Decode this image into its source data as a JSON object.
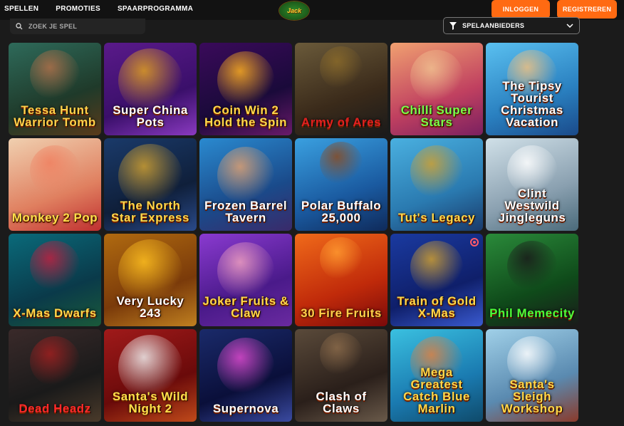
{
  "nav": {
    "games": "SPELLEN",
    "promotions": "PROMOTIES",
    "loyalty": "SPAARPROGRAMMA"
  },
  "logo_text": "Jack",
  "auth": {
    "login": "INLOGGEN",
    "register": "REGISTREREN"
  },
  "search": {
    "placeholder": "ZOEK JE SPEL"
  },
  "provider_filter": {
    "label": "SPELAANBIEDERS"
  },
  "colors": {
    "accent": "#ff6a12",
    "background": "#1b1b1b",
    "topbar": "#121212"
  },
  "games": [
    {
      "title": "Tessa Hunt Warrior Tomb",
      "bg": "linear-gradient(160deg,#2e6a5a,#1f3a2a 60%,#5a3a1a)",
      "art": "#b0704a",
      "color": "#ffd24a"
    },
    {
      "title": "Super China Pots",
      "bg": "linear-gradient(160deg,#5a1a8a,#3a0f6a 60%,#8a3ac0)",
      "art": "#e0a020",
      "color": "#ffffff"
    },
    {
      "title": "Coin Win 2 Hold the Spin",
      "bg": "linear-gradient(160deg,#3a0a5a,#1a0a3a 60%,#6a1a6a)",
      "art": "#ffb020",
      "color": "#ffd84a"
    },
    {
      "title": "Army of Ares",
      "bg": "linear-gradient(160deg,#6a5a3a,#3a2a1a 60%,#1a1a1a)",
      "art": "#8a6a2a",
      "color": "#e02020"
    },
    {
      "title": "Chilli Super Stars",
      "bg": "linear-gradient(160deg,#f0a070,#c04060 60%,#7a2060)",
      "art": "#f0c090",
      "color": "#7aff4a"
    },
    {
      "title": "The Tipsy Tourist Christmas Vacation",
      "bg": "linear-gradient(160deg,#5ac0f0,#2a80c0 60%,#1a4a8a)",
      "art": "#f0c080",
      "color": "#ffffff"
    },
    {
      "title": "Monkey 2 Pop",
      "bg": "linear-gradient(160deg,#f0d0b0,#e08060 60%,#c03030)",
      "art": "#f08060",
      "color": "#ffe04a"
    },
    {
      "title": "The North Star Express",
      "bg": "linear-gradient(160deg,#1a3a6a,#0f1f3a 60%,#2a4a8a)",
      "art": "#d0a030",
      "color": "#ffd84a"
    },
    {
      "title": "Frozen Barrel Tavern",
      "bg": "linear-gradient(160deg,#2a8ad0,#1a4a8a 60%,#3a2a6a)",
      "art": "#e0a070",
      "color": "#ffffff"
    },
    {
      "title": "Polar Buffalo 25,000",
      "bg": "linear-gradient(160deg,#3aa0e0,#1a5aa0 60%,#0f2a5a)",
      "art": "#8a4a20",
      "color": "#ffffff"
    },
    {
      "title": "Tut's Legacy",
      "bg": "linear-gradient(160deg,#4ab0e0,#2a7ab0 60%,#1a3a6a)",
      "art": "#d0a030",
      "color": "#ffd84a"
    },
    {
      "title": "Clint Westwild Jingleguns",
      "bg": "linear-gradient(160deg,#d0e0e8,#8aa0b0 60%,#4a6a7a)",
      "art": "#ffffff",
      "color": "#ffffff"
    },
    {
      "title": "X-Mas Dwarfs",
      "bg": "linear-gradient(160deg,#0a6a7a,#0a3a4a 60%,#1a5a3a)",
      "art": "#c02040",
      "color": "#ffd84a"
    },
    {
      "title": "Very Lucky 243",
      "bg": "linear-gradient(160deg,#b06a10,#7a3a0a 60%,#c08020)",
      "art": "#ffc020",
      "color": "#ffffff"
    },
    {
      "title": "Joker Fruits & Claw",
      "bg": "linear-gradient(160deg,#8a3ad0,#4a1a8a 60%,#6a2aa0)",
      "art": "#f0a0c0",
      "color": "#ffd84a"
    },
    {
      "title": "30 Fire Fruits",
      "bg": "linear-gradient(160deg,#f06a1a,#c02a0a 60%,#7a0a0a)",
      "art": "#ff9a30",
      "color": "#ffd04a"
    },
    {
      "title": "Train of Gold X-Mas",
      "bg": "linear-gradient(160deg,#1a3aa0,#0f1f6a 60%,#3a5ad0)",
      "art": "#d0a030",
      "color": "#ffd84a"
    },
    {
      "title": "Phil Memecity",
      "bg": "linear-gradient(160deg,#2a8a3a,#0f4a1a 60%,#1a1a1a)",
      "art": "#1a1a1a",
      "color": "#4aff3a"
    },
    {
      "title": "Dead Headz",
      "bg": "linear-gradient(160deg,#3a2a2a,#1a1a1a 60%,#4a3a2a)",
      "art": "#a02020",
      "color": "#ff2a2a"
    },
    {
      "title": "Santa's Wild Night 2",
      "bg": "linear-gradient(160deg,#a01a1a,#6a0a0a 60%,#c04a1a)",
      "art": "#f0f0f0",
      "color": "#ffe04a"
    },
    {
      "title": "Supernova",
      "bg": "linear-gradient(160deg,#1a2a6a,#0a0f3a 60%,#3a4aa0)",
      "art": "#e04ad0",
      "color": "#ffffff"
    },
    {
      "title": "Clash of Claws",
      "bg": "linear-gradient(160deg,#5a4a3a,#2a1f1a 60%,#6a5a4a)",
      "art": "#8a6a4a",
      "color": "#ffffff"
    },
    {
      "title": "Mega Greatest Catch Blue Marlin",
      "bg": "linear-gradient(160deg,#3ac0e0,#1a7ab0 60%,#0f4a6a)",
      "art": "#e08040",
      "color": "#ffd84a"
    },
    {
      "title": "Santa's Sleigh Workshop",
      "bg": "linear-gradient(160deg,#a0d0e8,#5a8ab0 60%,#8a3a2a)",
      "art": "#ffffff",
      "color": "#ffd84a"
    }
  ]
}
